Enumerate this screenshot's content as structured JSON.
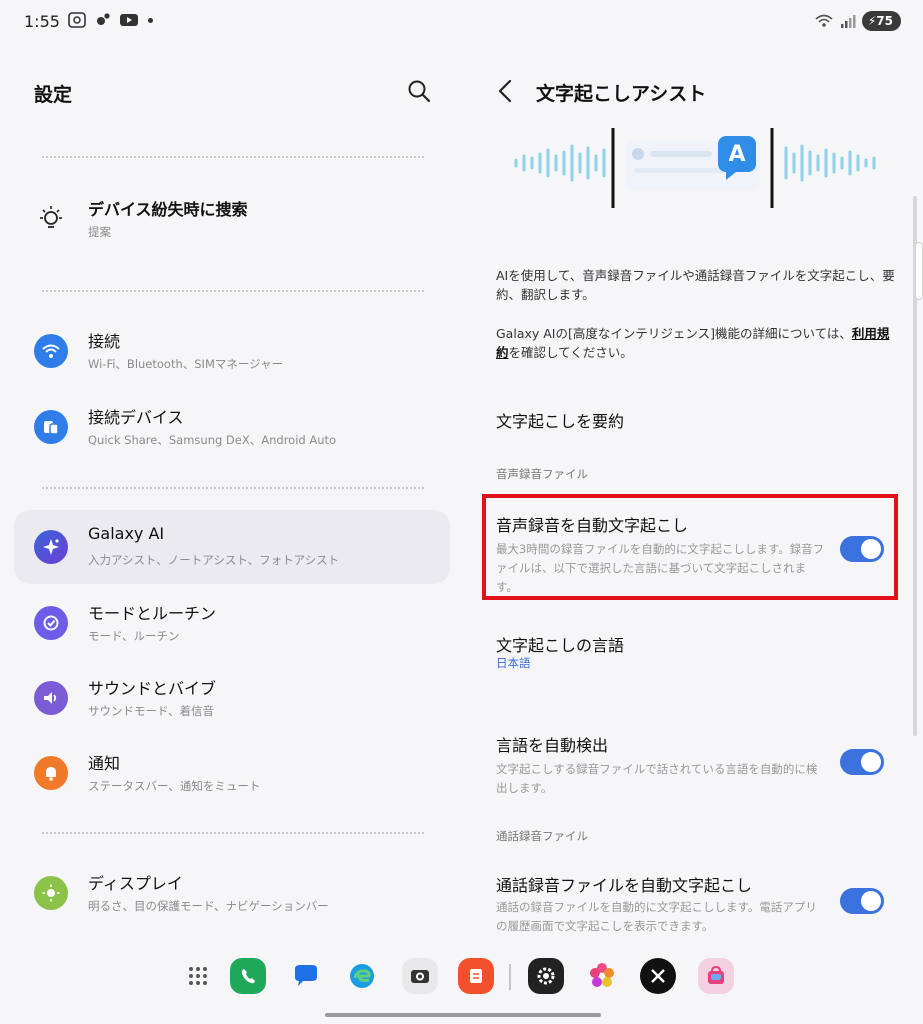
{
  "status_bar": {
    "time": "1:55",
    "battery": "75",
    "left_icons": [
      "screenshot-icon",
      "settings-sync-icon",
      "youtube-icon",
      "notification-dot"
    ],
    "right_icons": [
      "wifi-icon",
      "signal-icon",
      "battery-icon"
    ]
  },
  "left_panel": {
    "title": "設定",
    "items": [
      {
        "title": "デバイス紛失時に捜索",
        "sub": "提案",
        "icon": "lightbulb-icon",
        "color": "#ffffff"
      },
      {
        "title": "接続",
        "sub": "Wi-Fi、Bluetooth、SIMマネージャー",
        "icon": "wifi-icon",
        "color": "#2f7de8"
      },
      {
        "title": "接続デバイス",
        "sub": "Quick Share、Samsung DeX、Android Auto",
        "icon": "devices-icon",
        "color": "#2f7de8"
      },
      {
        "title": "Galaxy AI",
        "sub": "入力アシスト、ノートアシスト、フォトアシスト",
        "icon": "galaxy-ai-icon",
        "color": "#3a64d8"
      },
      {
        "title": "モードとルーチン",
        "sub": "モード、ルーチン",
        "icon": "routine-icon",
        "color": "#6c5ce7"
      },
      {
        "title": "サウンドとバイブ",
        "sub": "サウンドモード、着信音",
        "icon": "sound-icon",
        "color": "#7b5cd6"
      },
      {
        "title": "通知",
        "sub": "ステータスバー、通知をミュート",
        "icon": "bell-icon",
        "color": "#f07a2a"
      },
      {
        "title": "ディスプレイ",
        "sub": "明るさ、目の保護モード、ナビゲーションバー",
        "icon": "sun-icon",
        "color": "#8bc34a"
      }
    ]
  },
  "right_panel": {
    "title": "文字起こしアシスト",
    "description": "AIを使用して、音声録音ファイルや通話録音ファイルを文字起こし、要約、翻訳します。",
    "terms_prefix": "Galaxy AIの[高度なインテリジェンス]機能の詳細については、",
    "terms_link": "利用規約",
    "terms_suffix": "を確認してください。",
    "summarize": "文字起こしを要約",
    "section_voice": "音声録音ファイル",
    "auto_transcribe_title": "音声録音を自動文字起こし",
    "auto_transcribe_sub": "最大3時間の録音ファイルを自動的に文字起こしします。録音ファイルは、以下で選択した言語に基づいて文字起こしされます。",
    "language_title": "文字起こしの言語",
    "language_value": "日本語",
    "detect_title": "言語を自動検出",
    "detect_sub": "文字起こしする録音ファイルで話されている言語を自動的に検出します。",
    "section_call": "通話録音ファイル",
    "call_title": "通話録音ファイルを自動文字起こし",
    "call_sub": "通話の録音ファイルを自動的に文字起こしします。電話アプリの履歴画面で文字起こしを表示できます。",
    "illus_letter": "A",
    "toggles": {
      "auto_transcribe": true,
      "detect": true,
      "call": true
    },
    "highlight_color": "#e3101a"
  },
  "dock": {
    "apps": [
      "app-drawer-icon",
      "phone-icon",
      "messages-icon",
      "edge-icon",
      "camera-icon",
      "notes-icon",
      "settings-icon",
      "gallery-icon",
      "x-icon",
      "store-icon"
    ]
  }
}
